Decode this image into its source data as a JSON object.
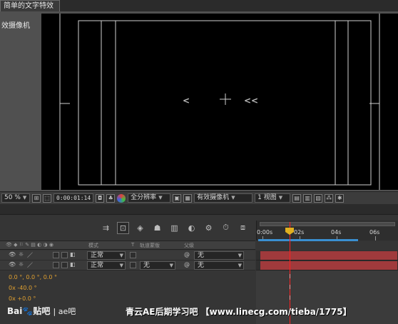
{
  "comp_tab": {
    "label": "简单的文字特效"
  },
  "viewer": {
    "camera_label": "效摄像机",
    "text_marks": [
      "<",
      "<<"
    ]
  },
  "viewer_bar": {
    "zoom": "50 %",
    "timecode": "0:00:01:14",
    "resolution": "全分辨率",
    "camera": "有效摄像机",
    "views": "1 视图"
  },
  "timeline": {
    "ruler_ticks": [
      "0:00s",
      "02s",
      "04s",
      "06s"
    ],
    "columns": {
      "mode": "模式",
      "t": "T",
      "trkmat": "轨道蒙版",
      "parent": "父级"
    },
    "layers": [
      {
        "mode": "正常",
        "trkmat": "",
        "parent": "无"
      },
      {
        "mode": "正常",
        "trkmat": "无",
        "parent": "无"
      }
    ],
    "properties": [
      "0.0 °, 0.0 °, 0.0 °",
      "0x -40.0 °",
      "0x +0.0 °"
    ]
  },
  "watermark": {
    "baidu": "Bai",
    "tieba": "贴吧",
    "forum": "ae吧",
    "site": "青云AE后期学习吧 【www.linecg.com/tieba/1775】"
  }
}
